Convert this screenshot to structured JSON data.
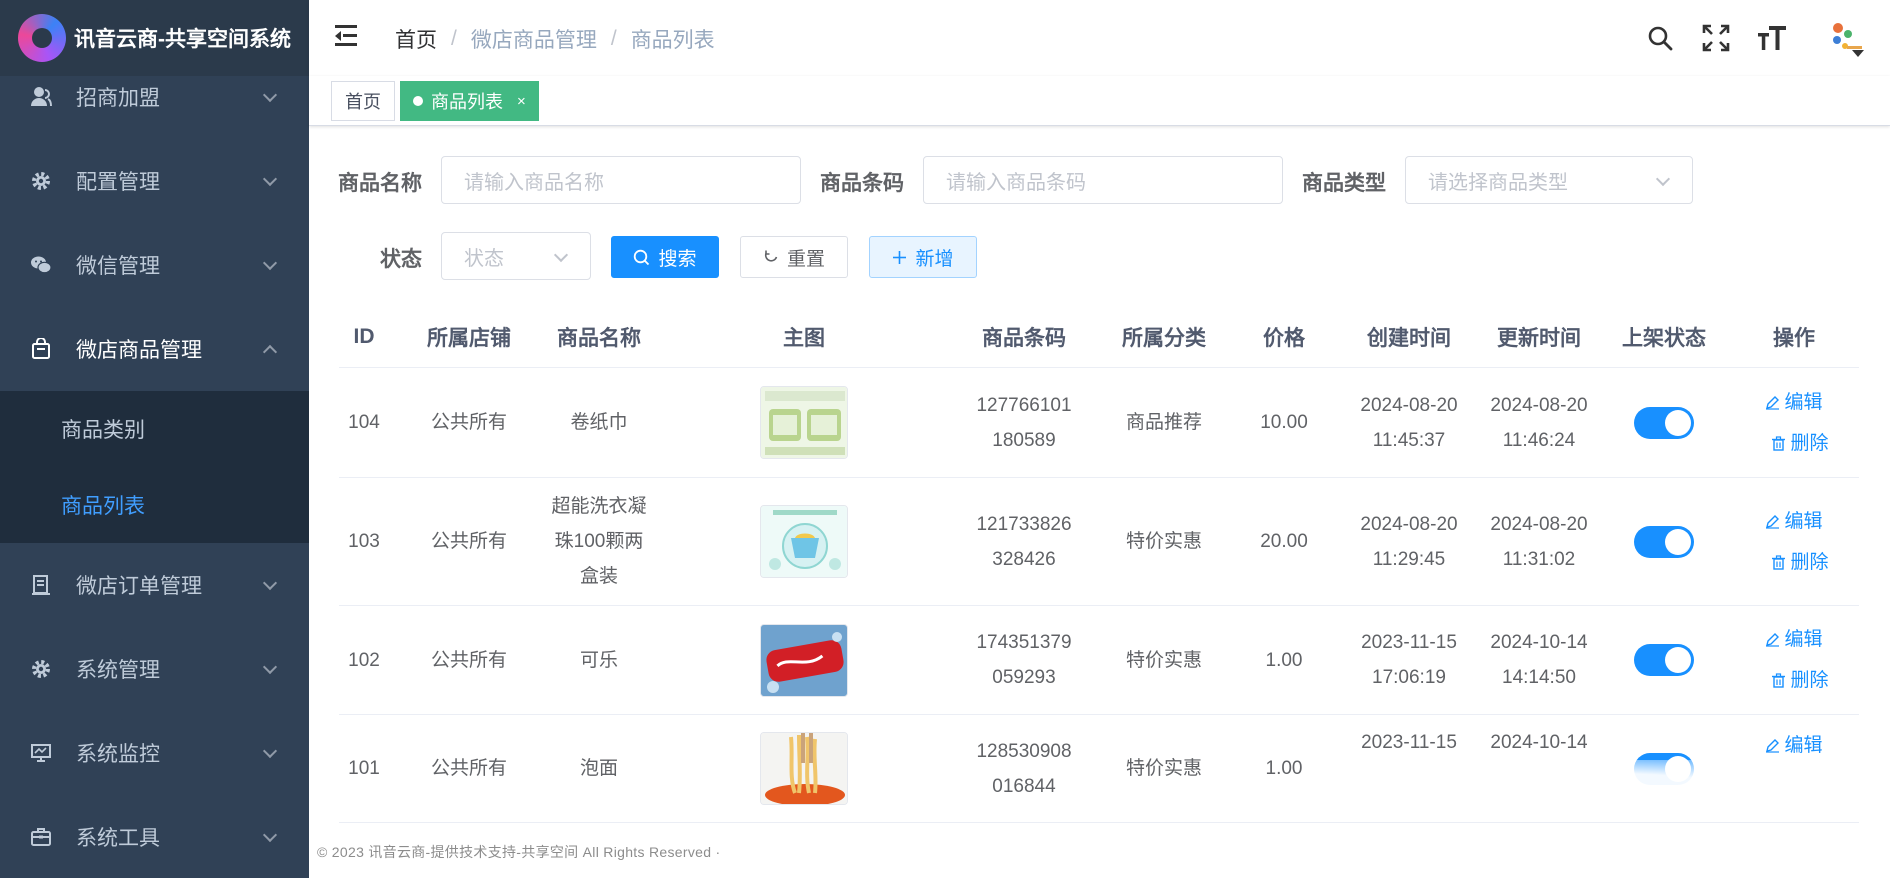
{
  "app": {
    "title": "讯音云商-共享空间系统"
  },
  "sidebar": {
    "items": [
      {
        "label": "招商加盟",
        "icon": "user-icon"
      },
      {
        "label": "配置管理",
        "icon": "gear-icon"
      },
      {
        "label": "微信管理",
        "icon": "wechat-icon"
      },
      {
        "label": "微店商品管理",
        "icon": "bag-icon",
        "open": true
      },
      {
        "label": "微店订单管理",
        "icon": "order-icon"
      },
      {
        "label": "系统管理",
        "icon": "gear-icon"
      },
      {
        "label": "系统监控",
        "icon": "monitor-icon"
      },
      {
        "label": "系统工具",
        "icon": "toolbox-icon"
      }
    ],
    "subitems": [
      {
        "label": "商品类别",
        "active": false
      },
      {
        "label": "商品列表",
        "active": true
      }
    ]
  },
  "breadcrumb": [
    "首页",
    "微店商品管理",
    "商品列表"
  ],
  "tags": {
    "home": "首页",
    "active": "商品列表",
    "close": "×"
  },
  "search": {
    "name_label": "商品名称",
    "name_placeholder": "请输入商品名称",
    "barcode_label": "商品条码",
    "barcode_placeholder": "请输入商品条码",
    "type_label": "商品类型",
    "type_placeholder": "请选择商品类型",
    "status_label": "状态",
    "status_placeholder": "状态",
    "search_btn": "搜索",
    "reset_btn": "重置",
    "add_btn": "新增"
  },
  "table": {
    "columns": [
      "ID",
      "所属店铺",
      "商品名称",
      "主图",
      "商品条码",
      "所属分类",
      "价格",
      "创建时间",
      "更新时间",
      "上架状态",
      "操作"
    ],
    "edit_label": "编辑",
    "delete_label": "删除",
    "rows": [
      {
        "id": "104",
        "shop": "公共所有",
        "name": "卷纸巾",
        "barcode": "127766101\n180589",
        "category": "商品推荐",
        "price": "10.00",
        "created": "2024-08-20\n11:45:37",
        "updated": "2024-08-20\n11:46:24",
        "on_shelf": true,
        "image": "tissue"
      },
      {
        "id": "103",
        "shop": "公共所有",
        "name": "超能洗衣凝\n珠100颗两\n盒装",
        "barcode": "121733826\n328426",
        "category": "特价实惠",
        "price": "20.00",
        "created": "2024-08-20\n11:29:45",
        "updated": "2024-08-20\n11:31:02",
        "on_shelf": true,
        "image": "laundry"
      },
      {
        "id": "102",
        "shop": "公共所有",
        "name": "可乐",
        "barcode": "174351379\n059293",
        "category": "特价实惠",
        "price": "1.00",
        "created": "2023-11-15\n17:06:19",
        "updated": "2024-10-14\n14:14:50",
        "on_shelf": true,
        "image": "cola"
      },
      {
        "id": "101",
        "shop": "公共所有",
        "name": "泡面",
        "barcode": "128530908\n016844",
        "category": "特价实惠",
        "price": "1.00",
        "created": "2023-11-15",
        "updated": "2024-10-14",
        "on_shelf": true,
        "image": "noodles"
      }
    ]
  },
  "footer": "© 2023 讯音云商-提供技术支持-共享空间 All Rights Reserved ·",
  "colors": {
    "sidebar_bg": "#304156",
    "primary": "#1890ff",
    "tag_active": "#42b983"
  }
}
